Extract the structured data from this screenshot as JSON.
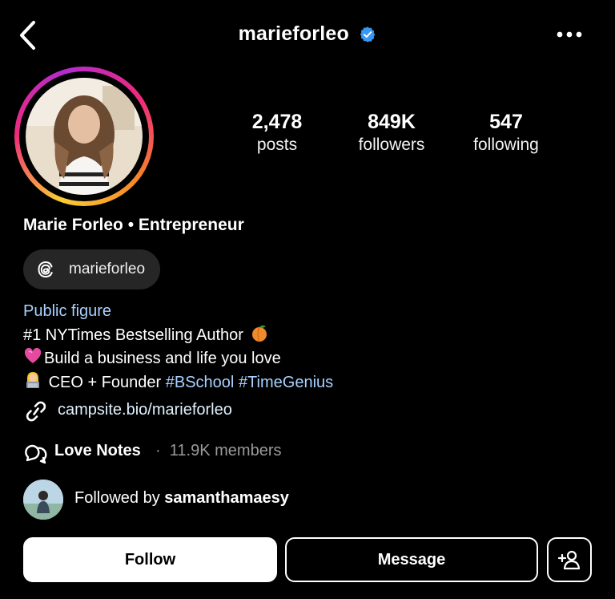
{
  "header": {
    "username": "marieforleo",
    "back_icon": "chevron-left-icon",
    "verified_icon": "verified-badge-icon",
    "more_icon": "more-horizontal-icon"
  },
  "profile": {
    "avatar_icon": "profile-photo",
    "stats": [
      {
        "value": "2,478",
        "label": "posts"
      },
      {
        "value": "849K",
        "label": "followers"
      },
      {
        "value": "547",
        "label": "following"
      }
    ],
    "display_name": "Marie Forleo • Entrepreneur",
    "threads": {
      "icon": "threads-icon",
      "handle": "marieforleo"
    },
    "bio": {
      "category": "Public figure",
      "line1": "#1 NYTimes Bestselling Author",
      "line2": "Build a business and life you love",
      "line3_prefix": "CEO + Founder",
      "hashtag1": "#BSchool",
      "hashtag2": "#TimeGenius"
    },
    "link": {
      "icon": "link-icon",
      "text": "campsite.bio/marieforleo"
    },
    "channel": {
      "icon": "broadcast-chat-icon",
      "name": "Love Notes",
      "separator": "·",
      "members": "11.9K members"
    },
    "followed_by": {
      "prefix": "Followed by",
      "username": "samanthamaesy"
    }
  },
  "actions": {
    "follow_label": "Follow",
    "message_label": "Message",
    "add_icon": "add-person-icon"
  },
  "colors": {
    "background": "#000000",
    "link_blue": "#a8d1ff",
    "verified_blue": "#3897f0",
    "pill": "#262626"
  }
}
